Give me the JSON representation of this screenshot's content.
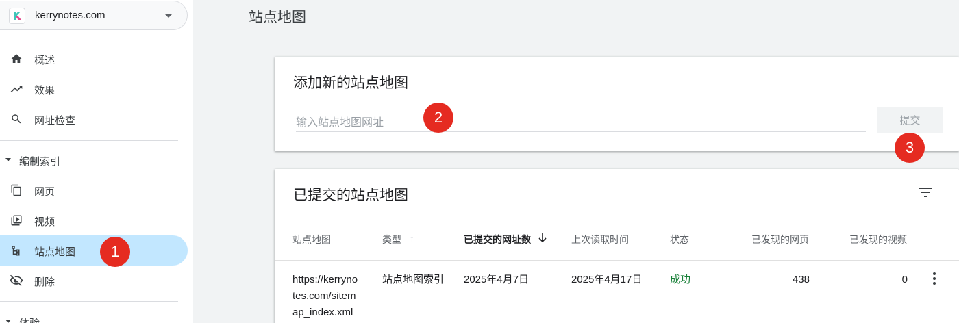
{
  "property": {
    "name": "kerrynotes.com",
    "logo_letter": "K"
  },
  "sidebar": {
    "items": [
      {
        "label": "概述",
        "icon": "home-icon"
      },
      {
        "label": "效果",
        "icon": "trending-up-icon"
      },
      {
        "label": "网址检查",
        "icon": "search-icon"
      }
    ],
    "indexing_section": "编制索引",
    "indexing_items": [
      {
        "label": "网页",
        "icon": "pages-icon"
      },
      {
        "label": "视频",
        "icon": "video-icon"
      },
      {
        "label": "站点地图",
        "icon": "sitemap-icon",
        "active": true
      },
      {
        "label": "删除",
        "icon": "removal-eye-off-icon"
      }
    ],
    "experience_section": "体验"
  },
  "page_title": "站点地图",
  "add_card": {
    "title": "添加新的站点地图",
    "input_placeholder": "输入站点地图网址",
    "input_value": "",
    "submit_label": "提交"
  },
  "submitted_card": {
    "title": "已提交的站点地图",
    "columns": [
      "站点地图",
      "类型",
      "已提交的网址数",
      "上次读取时间",
      "状态",
      "已发现的网页",
      "已发现的视频"
    ],
    "sorted_column": "已提交的网址数",
    "rows": [
      {
        "sitemap_line1": "https://kerryno",
        "sitemap_line2": "tes.com/sitem",
        "sitemap_line3": "ap_index.xml",
        "type": "站点地图索引",
        "submitted": "2025年4月7日",
        "last_read": "2025年4月17日",
        "status": "成功",
        "pages": "438",
        "videos": "0"
      }
    ]
  },
  "annotations": [
    "1",
    "2",
    "3"
  ],
  "colors": {
    "active_nav": "#c2e7ff",
    "success": "#188038",
    "badge": "#e52b21"
  }
}
